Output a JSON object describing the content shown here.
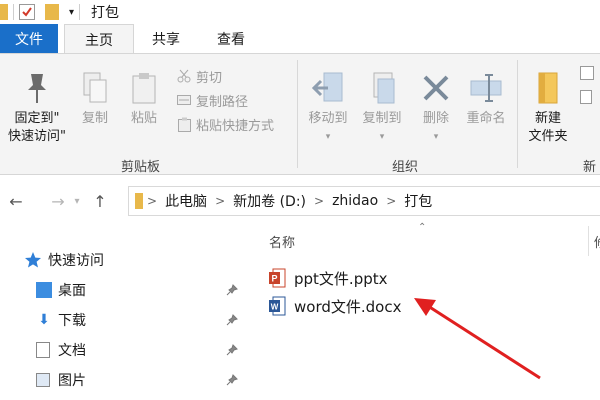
{
  "window": {
    "title": "打包"
  },
  "ribbon_tabs": {
    "file": "文件",
    "home": "主页",
    "share": "共享",
    "view": "查看"
  },
  "clipboard": {
    "label": "剪贴板",
    "pin_quick_access": [
      "固定到\"",
      "快速访问\""
    ],
    "copy": "复制",
    "paste": "粘贴",
    "cut": "剪切",
    "copy_path": "复制路径",
    "paste_shortcut": "粘贴快捷方式"
  },
  "organize": {
    "label": "组织",
    "move_to": "移动到",
    "copy_to": "复制到",
    "delete": "删除",
    "rename": "重命名"
  },
  "new_group": {
    "label": "新",
    "new_folder": [
      "新建",
      "文件夹"
    ]
  },
  "address": {
    "crumbs": [
      "此电脑",
      "新加卷 (D:)",
      "zhidao",
      "打包"
    ]
  },
  "nav_pane": {
    "quick_access": "快速访问",
    "items": [
      {
        "label": "桌面"
      },
      {
        "label": "下载"
      },
      {
        "label": "文档"
      },
      {
        "label": "图片"
      }
    ]
  },
  "file_list": {
    "col_name": "名称",
    "col_size_partial": "修",
    "files": [
      {
        "name": "ppt文件.pptx",
        "icon": "powerpoint-icon"
      },
      {
        "name": "word文件.docx",
        "icon": "word-icon"
      }
    ]
  },
  "colors": {
    "accent": "#1a6fc9",
    "arrow": "#e02020",
    "ppt": "#c8442b",
    "word": "#2b5797"
  }
}
